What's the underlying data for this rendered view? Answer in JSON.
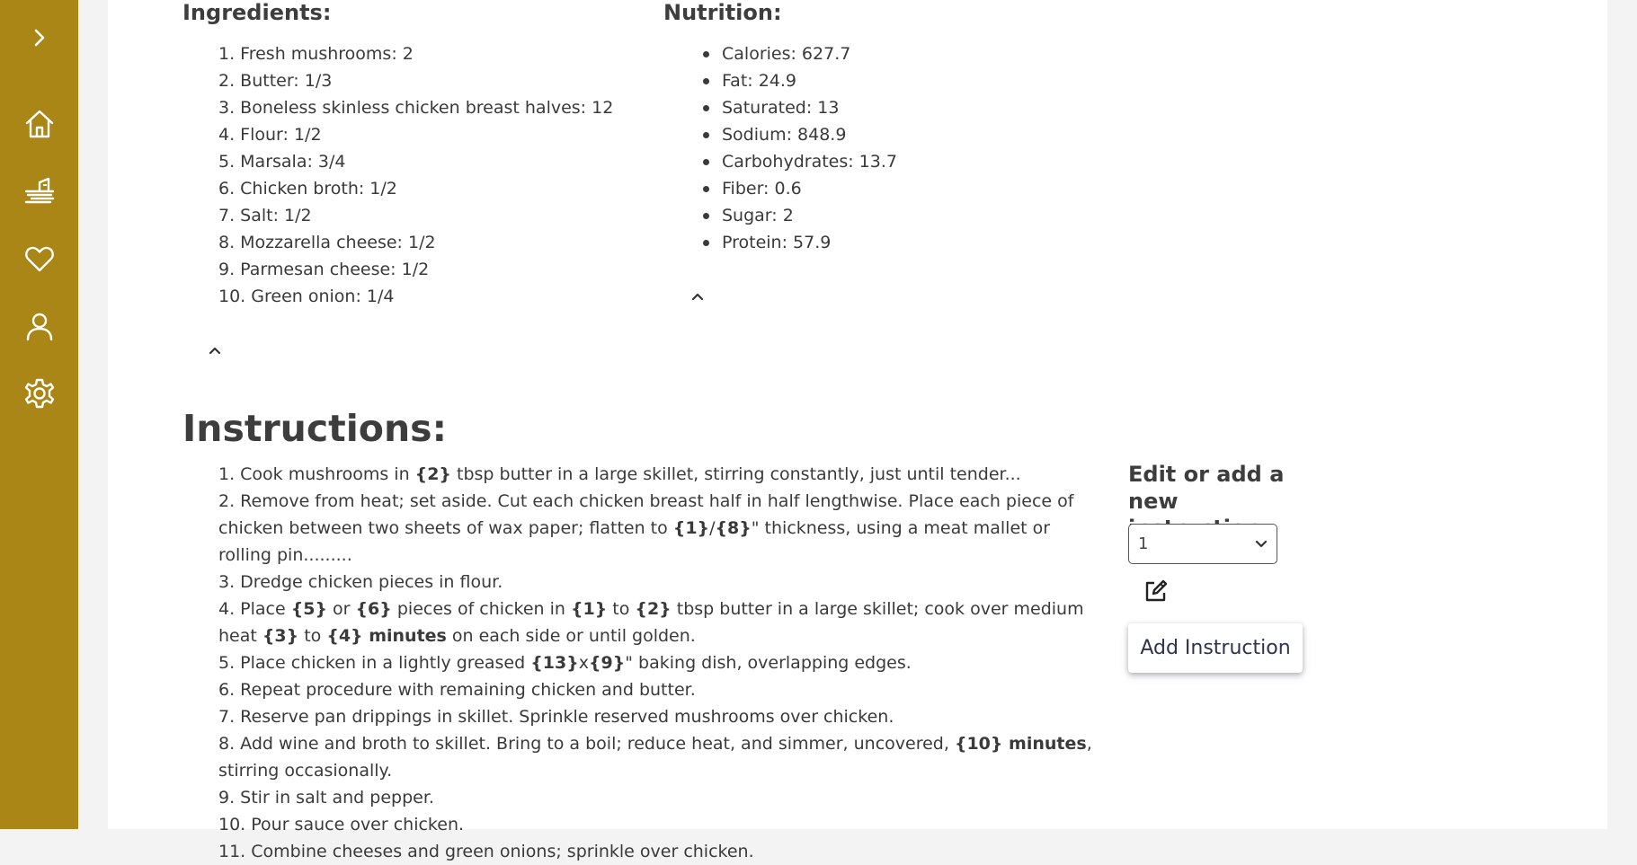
{
  "sidebar": {
    "items": [
      {
        "icon": "chevron-right-icon"
      },
      {
        "icon": "home-icon"
      },
      {
        "icon": "recipes-icon"
      },
      {
        "icon": "heart-icon"
      },
      {
        "icon": "user-icon"
      },
      {
        "icon": "gear-icon"
      }
    ],
    "color": "#a98615"
  },
  "ingredients": {
    "title": "Ingredients:",
    "items": [
      "1. Fresh mushrooms: 2",
      "2. Butter: 1/3",
      "3. Boneless skinless chicken breast halves: 12",
      "4. Flour: 1/2",
      "5. Marsala: 3/4",
      "6. Chicken broth: 1/2",
      "7. Salt: 1/2",
      "8. Mozzarella cheese: 1/2",
      "9. Parmesan cheese: 1/2",
      "10. Green onion: 1/4"
    ],
    "collapse_icon": "chevron-up-icon"
  },
  "nutrition": {
    "title": "Nutrition:",
    "items": [
      "Calories: 627.7",
      "Fat: 24.9",
      "Saturated: 13",
      "Sodium: 848.9",
      "Carbohydrates: 13.7",
      "Fiber: 0.6",
      "Sugar: 2",
      "Protein: 57.9"
    ],
    "collapse_icon": "chevron-up-icon"
  },
  "instructions": {
    "title": "Instructions:",
    "items": [
      [
        {
          "t": "1. Cook mushrooms in "
        },
        {
          "t": "{2}",
          "b": true
        },
        {
          "t": " tbsp butter in a large skillet, stirring constantly, just until tender..."
        }
      ],
      [
        {
          "t": "2. Remove from heat; set aside. Cut each chicken breast half in half lengthwise. Place each piece of chicken between two sheets of wax paper; flatten to "
        },
        {
          "t": "{1}",
          "b": true
        },
        {
          "t": "/"
        },
        {
          "t": "{8}",
          "b": true
        },
        {
          "t": "\" thickness, using a meat mallet or rolling pin........."
        }
      ],
      [
        {
          "t": "3. Dredge chicken pieces in flour."
        }
      ],
      [
        {
          "t": "4. Place "
        },
        {
          "t": "{5}",
          "b": true
        },
        {
          "t": " or "
        },
        {
          "t": "{6}",
          "b": true
        },
        {
          "t": " pieces of chicken in "
        },
        {
          "t": "{1}",
          "b": true
        },
        {
          "t": " to "
        },
        {
          "t": "{2}",
          "b": true
        },
        {
          "t": " tbsp butter in a large skillet; cook over medium heat "
        },
        {
          "t": "{3}",
          "b": true
        },
        {
          "t": " to "
        },
        {
          "t": "{4} minutes",
          "b": true
        },
        {
          "t": " on each side or until golden."
        }
      ],
      [
        {
          "t": "5. Place chicken in a lightly greased "
        },
        {
          "t": "{13}",
          "b": true
        },
        {
          "t": "x"
        },
        {
          "t": "{9}",
          "b": true
        },
        {
          "t": "\" baking dish, overlapping edges."
        }
      ],
      [
        {
          "t": "6. Repeat procedure with remaining chicken and butter."
        }
      ],
      [
        {
          "t": "7. Reserve pan drippings in skillet. Sprinkle reserved mushrooms over chicken."
        }
      ],
      [
        {
          "t": "8. Add wine and broth to skillet. Bring to a boil; reduce heat, and simmer, uncovered, "
        },
        {
          "t": "{10} minutes",
          "b": true
        },
        {
          "t": ", stirring occasionally."
        }
      ],
      [
        {
          "t": "9. Stir in salt and pepper."
        }
      ],
      [
        {
          "t": "10. Pour sauce over chicken."
        }
      ],
      [
        {
          "t": "11. Combine cheeses and green onions; sprinkle over chicken."
        }
      ]
    ]
  },
  "editor": {
    "heading": "Edit or add a new instruction",
    "select_value": "1",
    "edit_icon": "edit-icon",
    "add_button": "Add Instruction"
  }
}
